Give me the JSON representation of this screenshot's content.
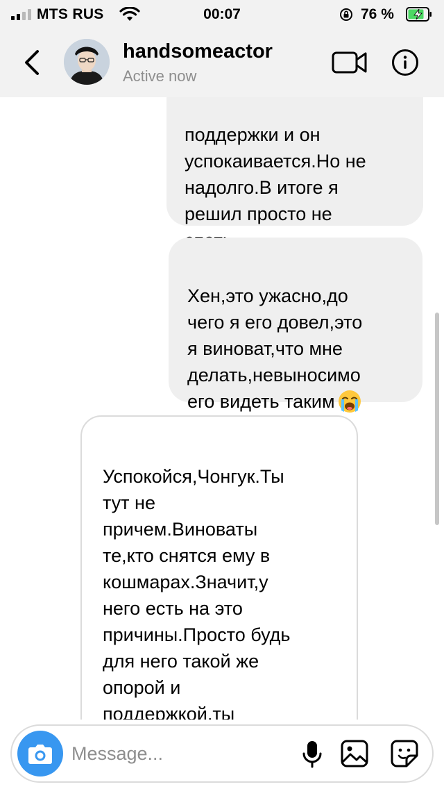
{
  "status_bar": {
    "carrier": "MTS RUS",
    "time": "00:07",
    "battery_percent": "76 %",
    "signal_bars_active": 2,
    "signal_bars_total": 4
  },
  "header": {
    "username": "handsomeactor",
    "status": "Active now"
  },
  "messages": [
    {
      "direction": "outgoing",
      "text": "поддержки и он\nуспокаивается.Но не\nнадолго.В итоге я\nрешил просто не\nспать"
    },
    {
      "direction": "outgoing",
      "text": "Хен,это ужасно,до\nчего я его довел,это\nя виноват,что мне\nделать,невыносимо\nего видеть таким",
      "emoji": "loudly-crying-face"
    },
    {
      "direction": "incoming",
      "text": "Успокойся,Чонгук.Ты\nтут не\nпричем.Виноваты\nте,кто снятся ему в\nкошмарах.Значит,у\nнего есть на это\nпричины.Просто будь\nдля него такой же\nопорой и\nподдержкой,ты\nумеешь это делать"
    }
  ],
  "composer": {
    "placeholder": "Message..."
  },
  "colors": {
    "accent": "#3897f0",
    "outgoing_bubble": "#efefef",
    "incoming_border": "#dbdbdb",
    "secondary_text": "#8e8e8e",
    "battery_green": "#4cd964"
  }
}
